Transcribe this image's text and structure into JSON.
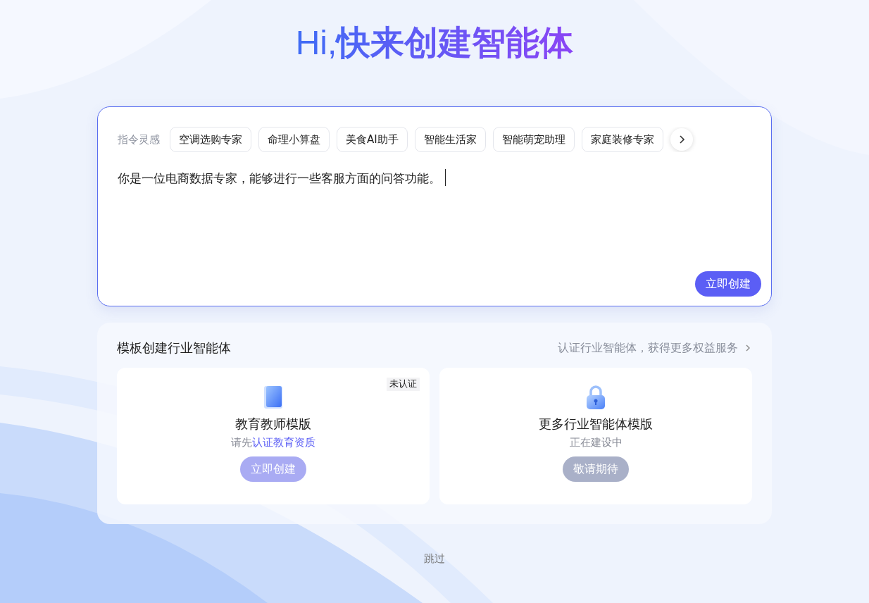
{
  "heading": {
    "prefix": "Hi,",
    "text": "快来创建智能体"
  },
  "prompt_card": {
    "inspiration_label": "指令灵感",
    "chips": [
      "空调选购专家",
      "命理小算盘",
      "美食AI助手",
      "智能生活家",
      "智能萌宠助理",
      "家庭装修专家"
    ],
    "value": "你是一位电商数据专家，能够进行一些客服方面的问答功能。",
    "focused": true,
    "create_button": "立即创建"
  },
  "templates": {
    "title": "模板创建行业智能体",
    "link": "认证行业智能体，获得更多权益服务",
    "cards": [
      {
        "kind": "book",
        "badge": "未认证",
        "title": "教育教师模版",
        "note": "请先",
        "note_link": "认证教育资质",
        "button": "立即创建"
      },
      {
        "kind": "lock",
        "title": "更多行业智能体模版",
        "note": "正在建设中",
        "button": "敬请期待"
      }
    ]
  },
  "skip": "跳过"
}
